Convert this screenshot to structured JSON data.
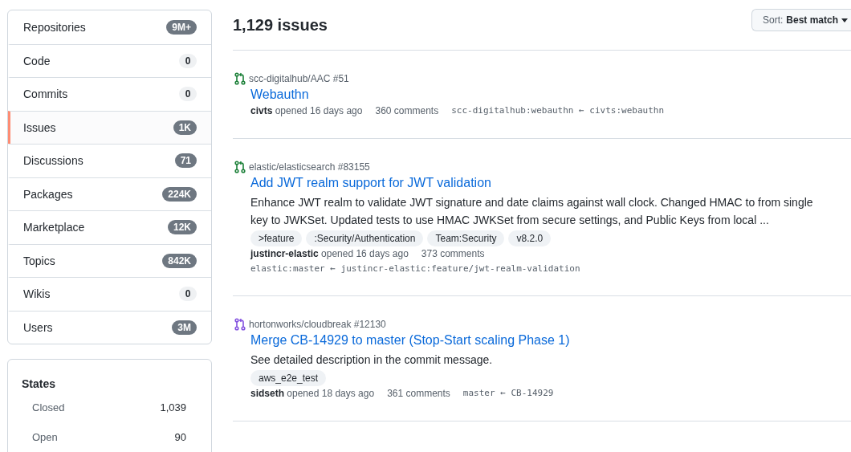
{
  "sidebar": {
    "items": [
      {
        "label": "Repositories",
        "count": "9M+",
        "kind": "dark",
        "selected": false
      },
      {
        "label": "Code",
        "count": "0",
        "kind": "light",
        "selected": false
      },
      {
        "label": "Commits",
        "count": "0",
        "kind": "light",
        "selected": false
      },
      {
        "label": "Issues",
        "count": "1K",
        "kind": "dark",
        "selected": true
      },
      {
        "label": "Discussions",
        "count": "71",
        "kind": "dark",
        "selected": false
      },
      {
        "label": "Packages",
        "count": "224K",
        "kind": "dark",
        "selected": false
      },
      {
        "label": "Marketplace",
        "count": "12K",
        "kind": "dark",
        "selected": false
      },
      {
        "label": "Topics",
        "count": "842K",
        "kind": "dark",
        "selected": false
      },
      {
        "label": "Wikis",
        "count": "0",
        "kind": "light",
        "selected": false
      },
      {
        "label": "Users",
        "count": "3M",
        "kind": "dark",
        "selected": false
      }
    ],
    "states": {
      "title": "States",
      "items": [
        {
          "label": "Closed",
          "count": "1,039"
        },
        {
          "label": "Open",
          "count": "90"
        }
      ]
    }
  },
  "results": {
    "title": "1,129 issues",
    "sort": {
      "label": "Sort:",
      "value": "Best match"
    },
    "items": [
      {
        "kind": "open",
        "repo": "scc-digitalhub/AAC",
        "number": "#51",
        "title": "Webauthn",
        "author": "civts",
        "opened": "opened 16 days ago",
        "comments": "360 comments",
        "branches": "scc-digitalhub:webauthn ← civts:webauthn",
        "branches_inline": true
      },
      {
        "kind": "open",
        "repo": "elastic/elasticsearch",
        "number": "#83155",
        "title": "Add JWT realm support for JWT validation",
        "description": [
          "Enhance JWT realm to validate JWT signature and date claims against wall clock. Changed HMAC to from single",
          "key to JWKSet. Updated tests to use HMAC JWKSet from secure settings, and Public Keys from local ..."
        ],
        "labels": [
          ">feature",
          ":Security/Authentication",
          "Team:Security",
          "v8.2.0"
        ],
        "author": "justincr-elastic",
        "opened": "opened 16 days ago",
        "comments": "373 comments",
        "branches": "elastic:master ← justincr-elastic:feature/jwt-realm-validation",
        "branches_inline": false
      },
      {
        "kind": "merged",
        "repo": "hortonworks/cloudbreak",
        "number": "#12130",
        "title": "Merge CB-14929 to master (Stop-Start scaling Phase 1)",
        "description": [
          "See detailed description in the commit message."
        ],
        "labels": [
          "aws_e2e_test"
        ],
        "author": "sidseth",
        "opened": "opened 18 days ago",
        "comments": "361 comments",
        "branches": "master ← CB-14929",
        "branches_inline": true
      }
    ]
  }
}
